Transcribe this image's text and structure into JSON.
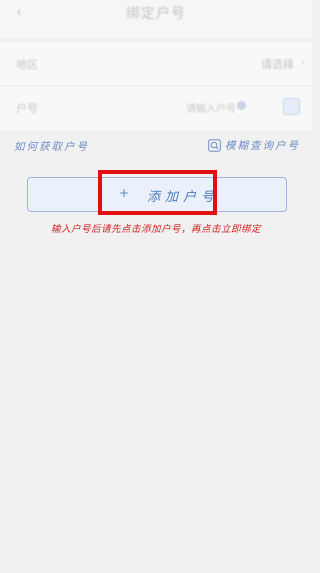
{
  "nav": {
    "back_icon": "arrow-left-icon",
    "title": "绑定户号"
  },
  "form": {
    "region": {
      "label": "地区",
      "value": "请选择"
    },
    "account": {
      "label": "户号",
      "placeholder": "请输入户号",
      "scan_icon": "scan-icon"
    }
  },
  "links": {
    "how_to_get": "如何获取户号",
    "fuzzy_search": "模糊查询户号"
  },
  "add_button": {
    "icon": "plus-icon",
    "label": "添加户号"
  },
  "instruction": "输入户号后请先点击添加户号，再点击立即绑定",
  "colors": {
    "link": "#6f8dc6",
    "button_border": "#9fb6d9",
    "button_bg": "#eaf1fa",
    "highlight": "#e01010",
    "instruction": "#d11f1f",
    "page_bg": "#f1f1f1"
  }
}
